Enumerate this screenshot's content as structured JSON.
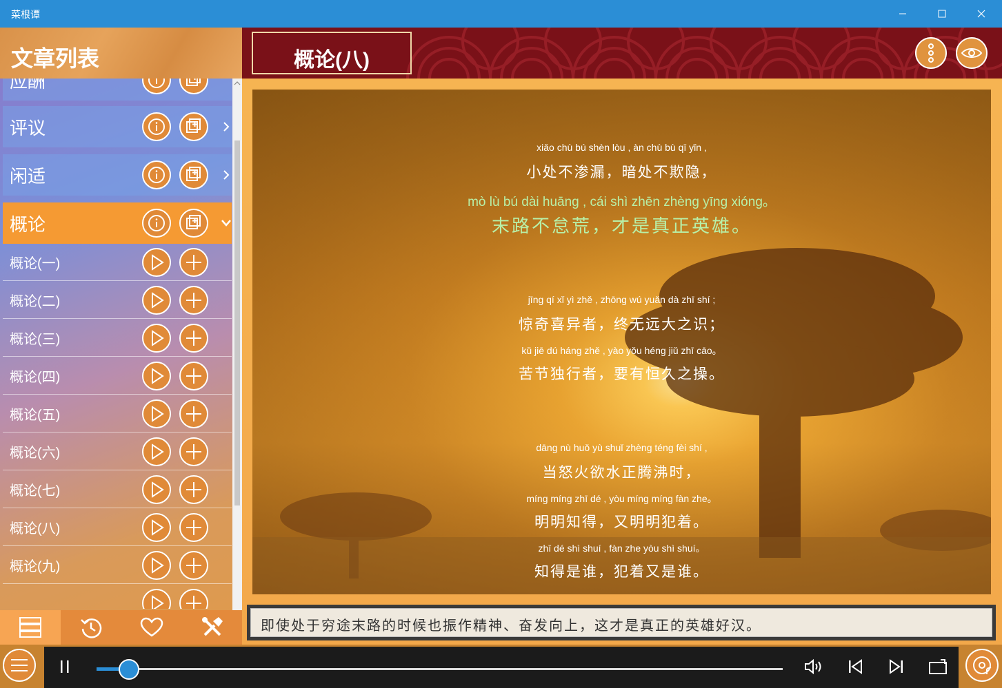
{
  "app": {
    "title": "菜根谭"
  },
  "sidebar": {
    "header": "文章列表",
    "categories": [
      {
        "label": "应酬",
        "expanded": false
      },
      {
        "label": "评议",
        "expanded": false
      },
      {
        "label": "闲适",
        "expanded": false
      },
      {
        "label": "概论",
        "expanded": true
      }
    ],
    "items": [
      {
        "label": "概论(一)"
      },
      {
        "label": "概论(二)"
      },
      {
        "label": "概论(三)"
      },
      {
        "label": "概论(四)"
      },
      {
        "label": "概论(五)"
      },
      {
        "label": "概论(六)"
      },
      {
        "label": "概论(七)"
      },
      {
        "label": "概论(八)"
      },
      {
        "label": "概论(九)"
      }
    ],
    "tabs": [
      "list-icon",
      "history-icon",
      "heart-icon",
      "tools-icon"
    ],
    "active_tab": "list-icon"
  },
  "main": {
    "title": "概论(八)",
    "stanzas": [
      [
        {
          "pinyin": "xiǎo chù bú shèn lòu , àn chù bù qī yǐn ,",
          "hanzi": "小处不渗漏，暗处不欺隐，",
          "highlight": false
        },
        {
          "pinyin": "mò lù bú dài huāng , cái shì zhēn zhèng yīng xióng。",
          "hanzi": "末路不怠荒，才是真正英雄。",
          "highlight": true
        }
      ],
      [
        {
          "pinyin": "jīng qí xǐ yì zhě , zhōng wú yuǎn dà zhī shí ;",
          "hanzi": "惊奇喜异者，终无远大之识；",
          "highlight": false
        },
        {
          "pinyin": "kǔ jiē dú háng zhě , yào yǒu héng jiǔ zhī cāo。",
          "hanzi": "苦节独行者，要有恒久之操。",
          "highlight": false
        }
      ],
      [
        {
          "pinyin": "dāng nù huǒ yù shuǐ zhèng téng fèi shí ,",
          "hanzi": "当怒火欲水正腾沸时，",
          "highlight": false
        },
        {
          "pinyin": "míng míng zhī dé , yòu míng míng fàn zhe。",
          "hanzi": "明明知得，又明明犯着。",
          "highlight": false
        },
        {
          "pinyin": "zhī dé shì shuí , fàn zhe yòu shì shuí。",
          "hanzi": "知得是谁，犯着又是谁。",
          "highlight": false
        }
      ]
    ],
    "translation": "即使处于穷途末路的时候也振作精神、奋发向上，这才是真正的英雄好汉。"
  },
  "player": {
    "progress": 0.047,
    "colors": {
      "accent": "#2b8ed6",
      "orange": "#e08a38",
      "header": "#7a1118"
    }
  }
}
